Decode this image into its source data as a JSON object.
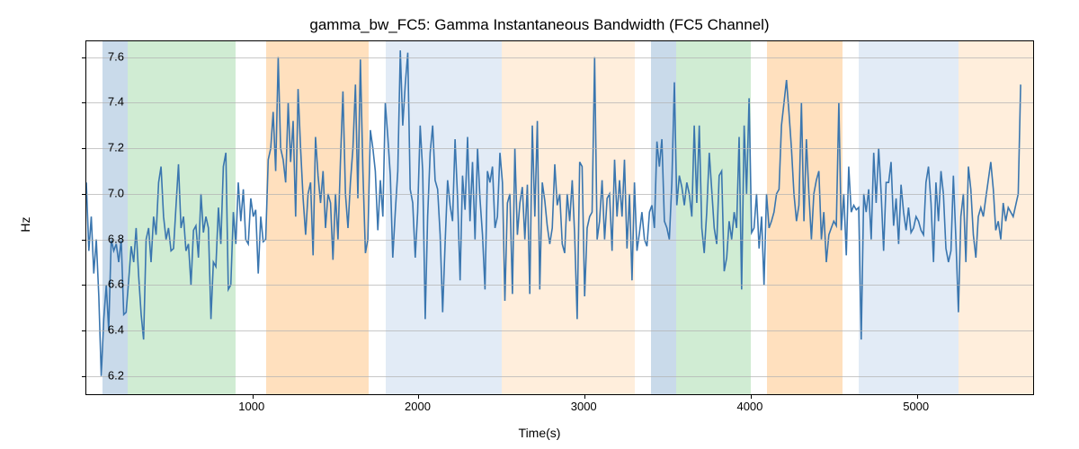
{
  "chart_data": {
    "type": "line",
    "title": "gamma_bw_FC5: Gamma Instantaneous Bandwidth (FC5 Channel)",
    "xlabel": "Time(s)",
    "ylabel": "Hz",
    "xlim": [
      0,
      5700
    ],
    "ylim": [
      6.12,
      7.67
    ],
    "xticks": [
      1000,
      2000,
      3000,
      4000,
      5000
    ],
    "yticks": [
      6.2,
      6.4,
      6.6,
      6.8,
      7.0,
      7.2,
      7.4,
      7.6
    ],
    "bands": [
      {
        "start": 100,
        "end": 250,
        "kind": "blue"
      },
      {
        "start": 250,
        "end": 900,
        "kind": "green"
      },
      {
        "start": 1080,
        "end": 1700,
        "kind": "orange"
      },
      {
        "start": 1800,
        "end": 2500,
        "kind": "lblue"
      },
      {
        "start": 2500,
        "end": 3300,
        "kind": "lorange"
      },
      {
        "start": 3400,
        "end": 3550,
        "kind": "blue"
      },
      {
        "start": 3550,
        "end": 4000,
        "kind": "green"
      },
      {
        "start": 4100,
        "end": 4550,
        "kind": "orange"
      },
      {
        "start": 4650,
        "end": 5250,
        "kind": "lblue"
      },
      {
        "start": 5250,
        "end": 5700,
        "kind": "lorange"
      }
    ],
    "series": [
      {
        "name": "gamma_bw_FC5",
        "color": "#3a76af",
        "x_step": 15,
        "values": [
          7.05,
          6.75,
          6.9,
          6.65,
          6.8,
          6.55,
          6.2,
          6.45,
          6.6,
          6.4,
          6.8,
          6.75,
          6.78,
          6.7,
          6.8,
          6.47,
          6.48,
          6.62,
          6.77,
          6.7,
          6.85,
          6.64,
          6.47,
          6.36,
          6.8,
          6.85,
          6.7,
          6.9,
          6.82,
          7.05,
          7.12,
          6.9,
          6.8,
          6.85,
          6.75,
          6.76,
          6.95,
          7.13,
          6.85,
          6.9,
          6.75,
          6.78,
          6.6,
          6.84,
          6.86,
          6.72,
          7.0,
          6.83,
          6.9,
          6.85,
          6.45,
          6.7,
          6.68,
          6.94,
          6.78,
          7.12,
          7.18,
          6.58,
          6.6,
          6.92,
          6.78,
          7.05,
          6.88,
          7.02,
          6.8,
          6.78,
          6.98,
          6.9,
          6.93,
          6.65,
          6.9,
          6.79,
          6.8,
          7.15,
          7.2,
          7.36,
          7.1,
          7.6,
          7.2,
          7.15,
          7.05,
          7.4,
          7.14,
          7.32,
          6.9,
          7.46,
          7.2,
          6.98,
          6.82,
          7.0,
          7.05,
          6.73,
          7.25,
          7.08,
          6.96,
          7.1,
          6.85,
          7.0,
          6.96,
          6.71,
          7.0,
          6.8,
          7.14,
          7.45,
          7.0,
          6.85,
          7.05,
          7.2,
          7.48,
          6.98,
          7.59,
          7.1,
          6.74,
          6.8,
          7.28,
          7.2,
          7.1,
          6.84,
          7.06,
          6.9,
          7.4,
          7.25,
          7.08,
          6.72,
          6.92,
          7.1,
          7.63,
          7.3,
          7.48,
          7.62,
          7.02,
          6.96,
          6.72,
          6.92,
          7.3,
          7.1,
          6.45,
          6.9,
          7.18,
          7.3,
          7.06,
          7.02,
          6.82,
          6.48,
          6.78,
          7.06,
          6.95,
          6.88,
          7.24,
          6.98,
          6.62,
          7.08,
          6.93,
          7.25,
          6.88,
          7.14,
          6.8,
          7.2,
          6.98,
          6.82,
          6.58,
          7.1,
          7.05,
          7.12,
          6.85,
          6.9,
          7.18,
          7.05,
          6.53,
          6.96,
          7.0,
          6.56,
          7.2,
          6.82,
          6.96,
          7.03,
          6.8,
          7.04,
          6.56,
          7.3,
          6.9,
          7.32,
          6.58,
          7.05,
          6.97,
          6.86,
          6.78,
          6.85,
          7.13,
          6.95,
          7.0,
          6.78,
          6.74,
          7.0,
          6.88,
          7.06,
          6.82,
          6.45,
          7.14,
          7.12,
          6.55,
          6.85,
          6.9,
          6.92,
          7.6,
          6.8,
          6.88,
          7.06,
          6.8,
          6.98,
          7.0,
          6.75,
          7.15,
          6.9,
          7.06,
          6.9,
          7.15,
          6.76,
          7.0,
          6.62,
          7.05,
          6.75,
          6.83,
          6.92,
          6.8,
          6.77,
          6.92,
          6.95,
          6.85,
          7.23,
          7.12,
          7.24,
          6.88,
          6.85,
          6.8,
          7.05,
          7.49,
          6.95,
          7.08,
          7.03,
          6.95,
          7.05,
          7.0,
          6.9,
          7.3,
          6.96,
          7.3,
          6.85,
          6.74,
          6.92,
          7.18,
          7.02,
          6.85,
          6.78,
          7.08,
          7.1,
          6.66,
          6.72,
          6.88,
          6.8,
          6.92,
          6.85,
          7.25,
          6.58,
          7.3,
          7.0,
          7.42,
          6.83,
          6.85,
          7.0,
          6.76,
          6.9,
          6.6,
          7.0,
          6.85,
          6.88,
          6.92,
          7.0,
          7.02,
          7.3,
          7.4,
          7.5,
          7.36,
          7.2,
          7.0,
          6.88,
          6.95,
          7.4,
          6.88,
          7.24,
          7.0,
          6.8,
          7.0,
          7.06,
          7.1,
          6.8,
          6.92,
          6.7,
          6.82,
          6.85,
          6.88,
          6.86,
          7.4,
          6.84,
          7.0,
          6.73,
          7.12,
          6.92,
          6.95,
          6.93,
          6.94,
          6.36,
          7.0,
          6.92,
          7.02,
          6.8,
          7.18,
          6.96,
          7.2,
          7.0,
          6.75,
          7.05,
          7.05,
          7.14,
          6.86,
          6.98,
          6.78,
          7.04,
          6.92,
          6.84,
          6.94,
          6.83,
          6.85,
          6.9,
          6.88,
          6.84,
          6.82,
          7.05,
          7.12,
          6.96,
          6.7,
          7.05,
          6.88,
          7.1,
          7.0,
          6.76,
          6.7,
          6.75,
          7.08,
          6.8,
          6.48,
          6.9,
          7.0,
          6.7,
          7.12,
          7.02,
          6.82,
          6.72,
          6.9,
          6.94,
          6.9,
          6.98,
          7.06,
          7.14,
          7.02,
          6.84,
          6.88,
          6.8,
          6.96,
          6.88,
          6.94,
          6.92,
          6.9,
          6.95,
          7.0,
          7.48
        ]
      }
    ]
  }
}
